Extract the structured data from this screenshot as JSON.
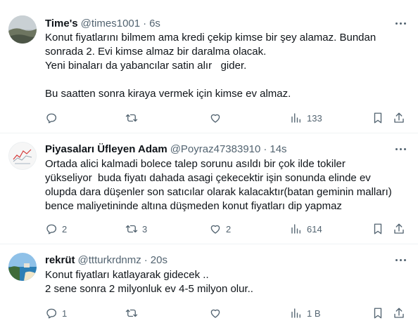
{
  "tweets": [
    {
      "name": "Time's",
      "handle": "@times1001",
      "time": "6s",
      "lines": [
        "Konut fiyatlarını bilmem ama kredi çekip kimse bir şey alamaz. Bundan",
        "sonrada 2. Evi kimse almaz bir daralma olacak.",
        "Yeni binaları da yabancılar satin alır   gider.",
        "",
        "Bu saatten sonra kiraya vermek için kimse ev almaz."
      ],
      "replies": "",
      "retweets": "",
      "likes": "",
      "views": "133"
    },
    {
      "name": "Piyasaları Üfleyen Adam",
      "handle": "@Poyraz47383910",
      "time": "14s",
      "lines": [
        "Ortada alici kalmadi bolece talep sorunu asıldı bir çok ilde tokiler",
        "yükseliyor  buda fiyatı dahada asagi çekecektir işin sonunda elinde ev",
        "olupda dara düşenler son satıcılar olarak kalacaktır(batan geminin malları)",
        "bence maliyetininde altına düşmeden konut fiyatları dip yapmaz"
      ],
      "replies": "2",
      "retweets": "3",
      "likes": "2",
      "views": "614"
    },
    {
      "name": "rekrüt",
      "handle": "@ttturkrdnmz",
      "time": "20s",
      "lines": [
        "Konut fiyatları katlayarak gidecek ..",
        "2 sene sonra 2 milyonluk ev 4-5 milyon olur.."
      ],
      "replies": "1",
      "retweets": "",
      "likes": "",
      "views": "1 B"
    }
  ],
  "colors": {
    "text": "#0f1419",
    "secondary": "#536471",
    "divider": "#eff3f4"
  },
  "icons": [
    "reply-icon",
    "retweet-icon",
    "like-icon",
    "views-icon",
    "bookmark-icon",
    "share-icon",
    "more-icon"
  ]
}
